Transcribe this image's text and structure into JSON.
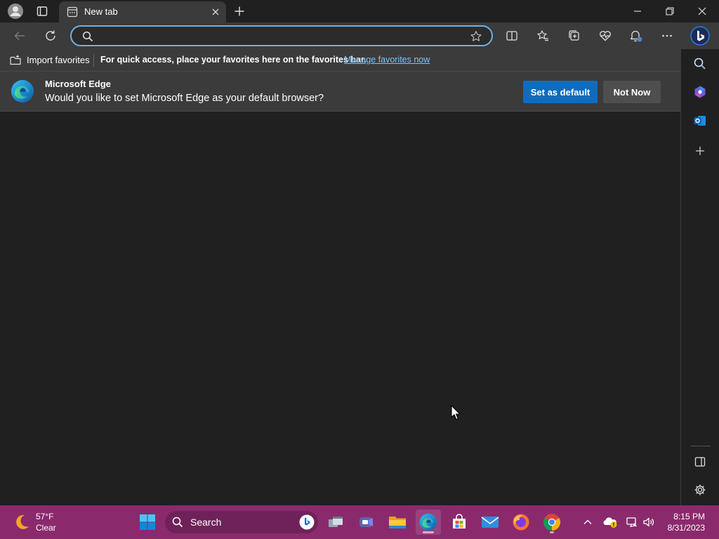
{
  "window": {
    "tab_title": "New tab"
  },
  "address_bar": {
    "value": "",
    "placeholder": ""
  },
  "favorites_bar": {
    "import_label": "Import favorites",
    "message": "For quick access, place your favorites here on the favorites bar.",
    "link_label": "Manage favorites now"
  },
  "banner": {
    "title": "Microsoft Edge",
    "message": "Would you like to set Microsoft Edge as your default browser?",
    "primary_label": "Set as default",
    "secondary_label": "Not Now"
  },
  "taskbar": {
    "weather_temp": "57°F",
    "weather_condition": "Clear",
    "search_label": "Search",
    "time": "8:15 PM",
    "date": "8/31/2023"
  },
  "colors": {
    "accent": "#0f6cbd",
    "taskbar": "#8a2a6d",
    "link": "#7cc4ff"
  }
}
